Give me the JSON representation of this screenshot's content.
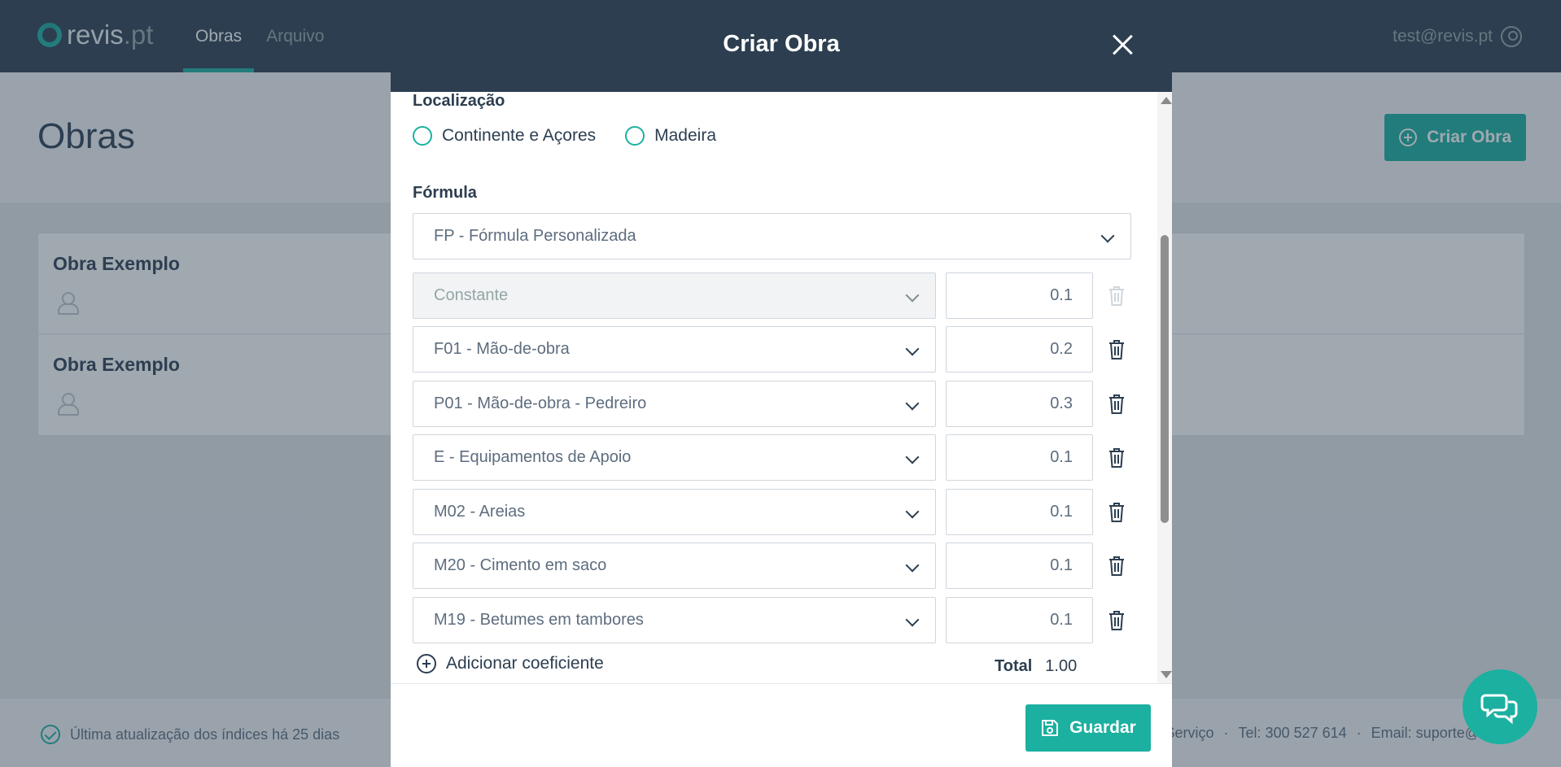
{
  "brand": {
    "name": "revis",
    "domain": ".pt"
  },
  "nav": [
    {
      "label": "Obras"
    },
    {
      "label": "Arquivo"
    }
  ],
  "user": {
    "email": "test@revis.pt"
  },
  "page": {
    "title": "Obras",
    "create_label": "Criar Obra"
  },
  "obras": [
    {
      "title": "Obra Exemplo"
    },
    {
      "title": "Obra Exemplo"
    }
  ],
  "footer": {
    "update_text": "Última atualização dos índices há 25 dias",
    "links": [
      "Serviço",
      "·",
      "Tel: 300 527 614",
      "·",
      "Email: suporte@"
    ]
  },
  "modal": {
    "title": "Criar Obra",
    "location_label": "Localização",
    "location_options": [
      "Continente e Açores",
      "Madeira"
    ],
    "formula_label": "Fórmula",
    "formula_value": "FP - Fórmula Personalizada",
    "coefficients": [
      {
        "name": "Constante",
        "value": "0.1"
      },
      {
        "name": "F01 - Mão-de-obra",
        "value": "0.2"
      },
      {
        "name": "P01 - Mão-de-obra - Pedreiro",
        "value": "0.3"
      },
      {
        "name": "E - Equipamentos de Apoio",
        "value": "0.1"
      },
      {
        "name": "M02 - Areias",
        "value": "0.1"
      },
      {
        "name": "M20 - Cimento em saco",
        "value": "0.1"
      },
      {
        "name": "M19 - Betumes em tambores",
        "value": "0.1"
      }
    ],
    "add_label": "Adicionar coeficiente",
    "total_label": "Total",
    "total_value": "1.00",
    "save_label": "Guardar"
  },
  "colors": {
    "accent": "#1bb0a0",
    "header": "#2c3e50"
  }
}
